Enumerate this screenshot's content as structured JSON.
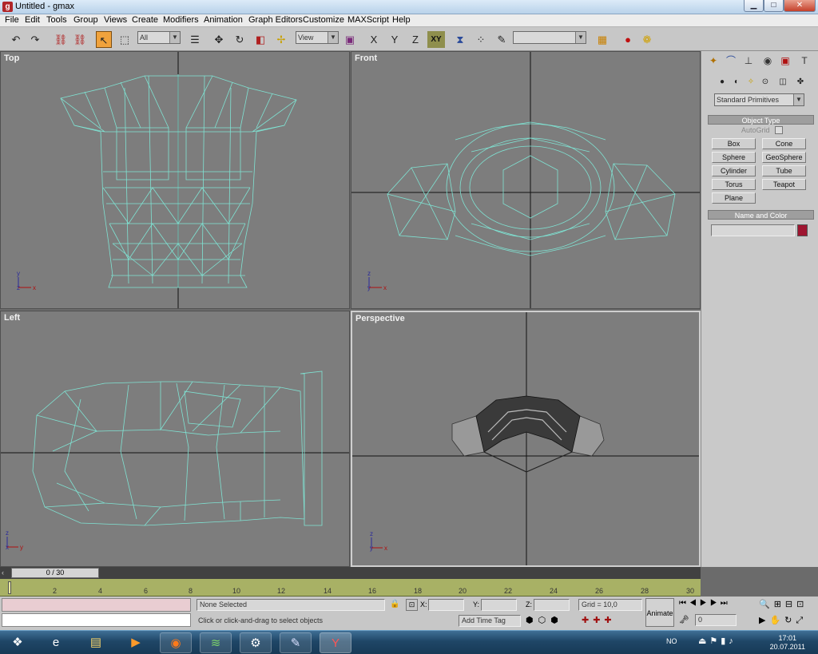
{
  "window": {
    "title": "Untitled - gmax",
    "icon": "gmax-logo-icon",
    "controls": [
      "minimize-icon",
      "maximize-icon",
      "close-icon"
    ]
  },
  "menu": [
    "File",
    "Edit",
    "Tools",
    "Group",
    "Views",
    "Create",
    "Modifiers",
    "Animation",
    "Graph Editors",
    "Customize",
    "MAXScript",
    "Help"
  ],
  "toolbar": {
    "selection_filter": "All",
    "reference_coord": "View",
    "axis_x": "X",
    "axis_y": "Y",
    "axis_z": "Z",
    "axis_xy": "XY",
    "named_selection": ""
  },
  "viewports": {
    "top": "Top",
    "front": "Front",
    "left": "Left",
    "perspective": "Perspective"
  },
  "command_panel": {
    "category_dropdown": "Standard Primitives",
    "object_type_header": "Object Type",
    "autogrid_label": "AutoGrid",
    "buttons": [
      "Box",
      "Cone",
      "Sphere",
      "GeoSphere",
      "Cylinder",
      "Tube",
      "Torus",
      "Teapot",
      "Plane"
    ],
    "name_color_header": "Name and Color",
    "object_name": "",
    "object_color": "#9e1530"
  },
  "timeline": {
    "slider": "0 / 30",
    "ticks": [
      "2",
      "4",
      "6",
      "8",
      "10",
      "12",
      "14",
      "16",
      "18",
      "20",
      "22",
      "24",
      "26",
      "28",
      "30"
    ]
  },
  "status": {
    "selection": "None Selected",
    "prompt": "Click or click-and-drag to select objects",
    "x_label": "X:",
    "y_label": "Y:",
    "z_label": "Z:",
    "x_value": "",
    "y_value": "",
    "z_value": "",
    "grid": "Grid = 10,0",
    "add_time_tag": "Add Time Tag",
    "animate": "Animate",
    "frame": "0"
  },
  "taskbar": {
    "language": "NO",
    "time": "17:01",
    "date": "20.07.2011"
  },
  "colors": {
    "wireframe": "#7fe3d3",
    "viewport_bg": "#7d7d7d",
    "timeline": "#a8b165",
    "accent": "#f0a23c"
  }
}
